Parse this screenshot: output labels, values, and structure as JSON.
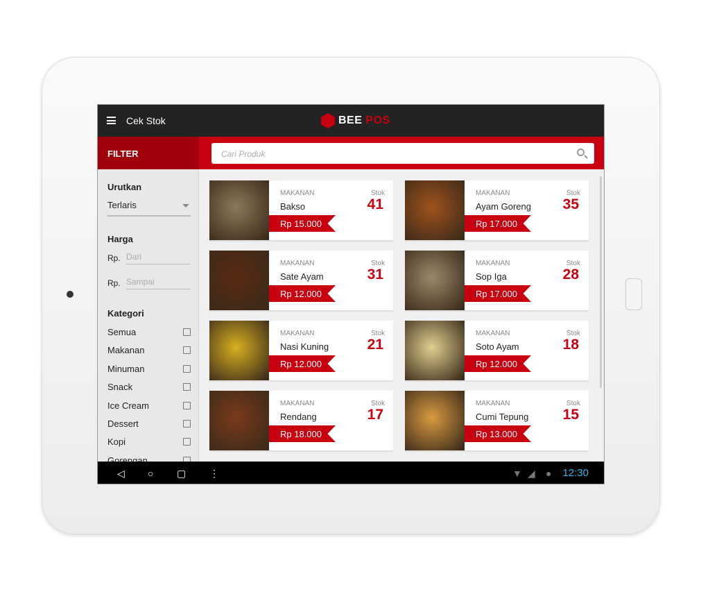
{
  "header": {
    "title": "Cek Stok",
    "logo": "BEEPOS",
    "menu_icon": "hamburger-icon"
  },
  "filter": {
    "title": "FILTER",
    "sort_label": "Urutkan",
    "sort_value": "Terlaris",
    "price_label": "Harga",
    "currency": "Rp.",
    "from_placeholder": "Dari",
    "to_placeholder": "Sampai",
    "category_label": "Kategori",
    "categories": [
      "Semua",
      "Makanan",
      "Minuman",
      "Snack",
      "Ice Cream",
      "Dessert",
      "Kopi",
      "Gorengan"
    ]
  },
  "search": {
    "placeholder": "Cari Produk"
  },
  "stock_label": "Stok",
  "products": [
    {
      "category": "MAKANAN",
      "name": "Bakso",
      "stock": "41",
      "price": "Rp 15.000",
      "color": "#8a7a5a"
    },
    {
      "category": "MAKANAN",
      "name": "Ayam Goreng",
      "stock": "35",
      "price": "Rp 17.000",
      "color": "#a0521c"
    },
    {
      "category": "MAKANAN",
      "name": "Sate Ayam",
      "stock": "31",
      "price": "Rp 12.000",
      "color": "#5a2a14"
    },
    {
      "category": "MAKANAN",
      "name": "Sop Iga",
      "stock": "28",
      "price": "Rp 17.000",
      "color": "#9a8a6a"
    },
    {
      "category": "MAKANAN",
      "name": "Nasi Kuning",
      "stock": "21",
      "price": "Rp 12.000",
      "color": "#d8b020"
    },
    {
      "category": "MAKANAN",
      "name": "Soto Ayam",
      "stock": "18",
      "price": "Rp 12.000",
      "color": "#e0d090"
    },
    {
      "category": "MAKANAN",
      "name": "Rendang",
      "stock": "17",
      "price": "Rp 18.000",
      "color": "#7a3a1a"
    },
    {
      "category": "MAKANAN",
      "name": "Cumi Tepung",
      "stock": "15",
      "price": "Rp 13.000",
      "color": "#d89a40"
    }
  ],
  "statusbar": {
    "time": "12:30"
  },
  "colors": {
    "accent": "#c8000f",
    "dark": "#232323",
    "clock": "#33b5e5"
  }
}
